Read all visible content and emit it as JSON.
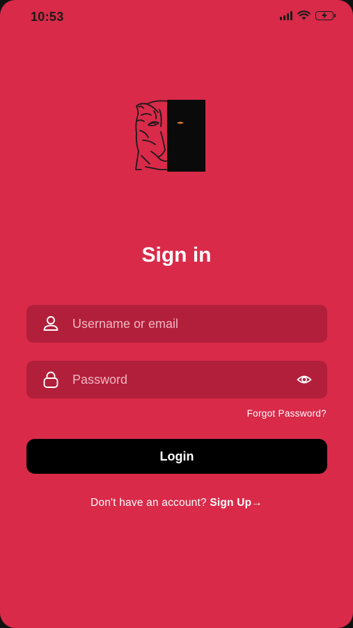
{
  "status_bar": {
    "time": "10:53",
    "icons": [
      "cellular-signal-icon",
      "wifi-icon",
      "battery-charging-icon"
    ]
  },
  "colors": {
    "background": "#d92a49",
    "field_background": "#b21f3b",
    "button_background": "#000000",
    "text": "#ffffff"
  },
  "logo": {
    "icon": "tiger-face-logo"
  },
  "title": "Sign in",
  "username_field": {
    "placeholder": "Username or email",
    "value": "",
    "icon": "user-icon"
  },
  "password_field": {
    "placeholder": "Password",
    "value": "",
    "icon": "lock-icon",
    "toggle_icon": "eye-icon"
  },
  "forgot_password": "Forgot Password?",
  "login_button": "Login",
  "signup": {
    "prompt": "Don't have an account?",
    "link": "Sign Up",
    "arrow": "→"
  }
}
